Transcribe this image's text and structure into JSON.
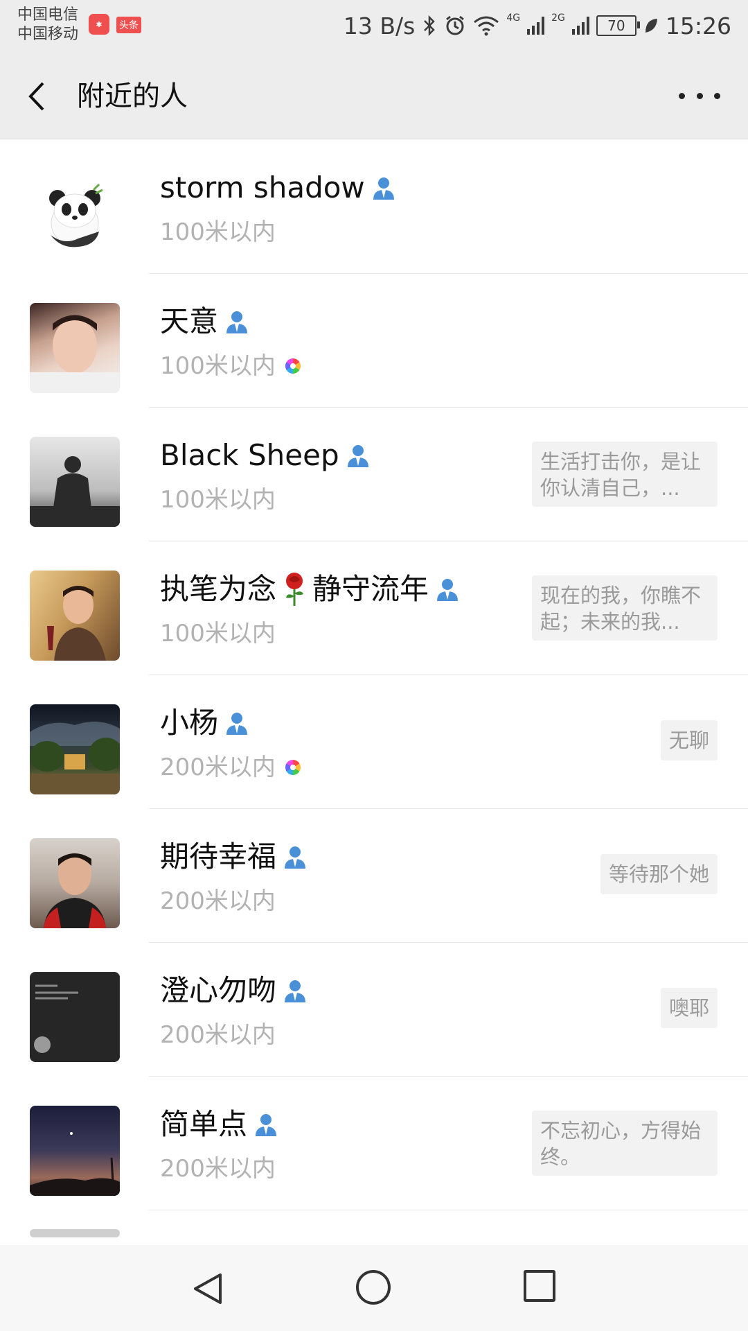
{
  "status_bar": {
    "carrier_1": "中国电信",
    "carrier_2": "中国移动",
    "app_badge_1": "头条",
    "net_speed": "13 B/s",
    "network_1": "4G",
    "network_2": "2G",
    "battery": "70",
    "time": "15:26"
  },
  "header": {
    "title": "附近的人"
  },
  "people": [
    {
      "name": "storm shadow",
      "distance": "100米以内",
      "signature": "",
      "moments": false,
      "avatar_color": "#f3f1ea"
    },
    {
      "name": "天意",
      "distance": "100米以内",
      "signature": "",
      "moments": true,
      "avatar_color": "#d9b7a3"
    },
    {
      "name": "Black Sheep",
      "distance": "100米以内",
      "signature": "生活打击你，是让你认清自己，...",
      "moments": false,
      "avatar_color": "#6c6c6c"
    },
    {
      "name_before": "执笔为念",
      "name_after": "静守流年",
      "distance": "100米以内",
      "signature": "现在的我，你瞧不起；未来的我...",
      "moments": false,
      "avatar_color": "#c8a26b"
    },
    {
      "name": "小杨",
      "distance": "200米以内",
      "signature": "无聊",
      "moments": true,
      "avatar_color": "#3b4a2a"
    },
    {
      "name": "期待幸福",
      "distance": "200米以内",
      "signature": "等待那个她",
      "moments": false,
      "avatar_color": "#8a6f5d"
    },
    {
      "name": "澄心勿吻",
      "distance": "200米以内",
      "signature": "噢耶",
      "moments": false,
      "avatar_color": "#2a2a2a"
    },
    {
      "name": "简单点",
      "distance": "200米以内",
      "signature": "不忘初心，方得始终。",
      "moments": false,
      "avatar_color": "#3d3a5a"
    }
  ]
}
